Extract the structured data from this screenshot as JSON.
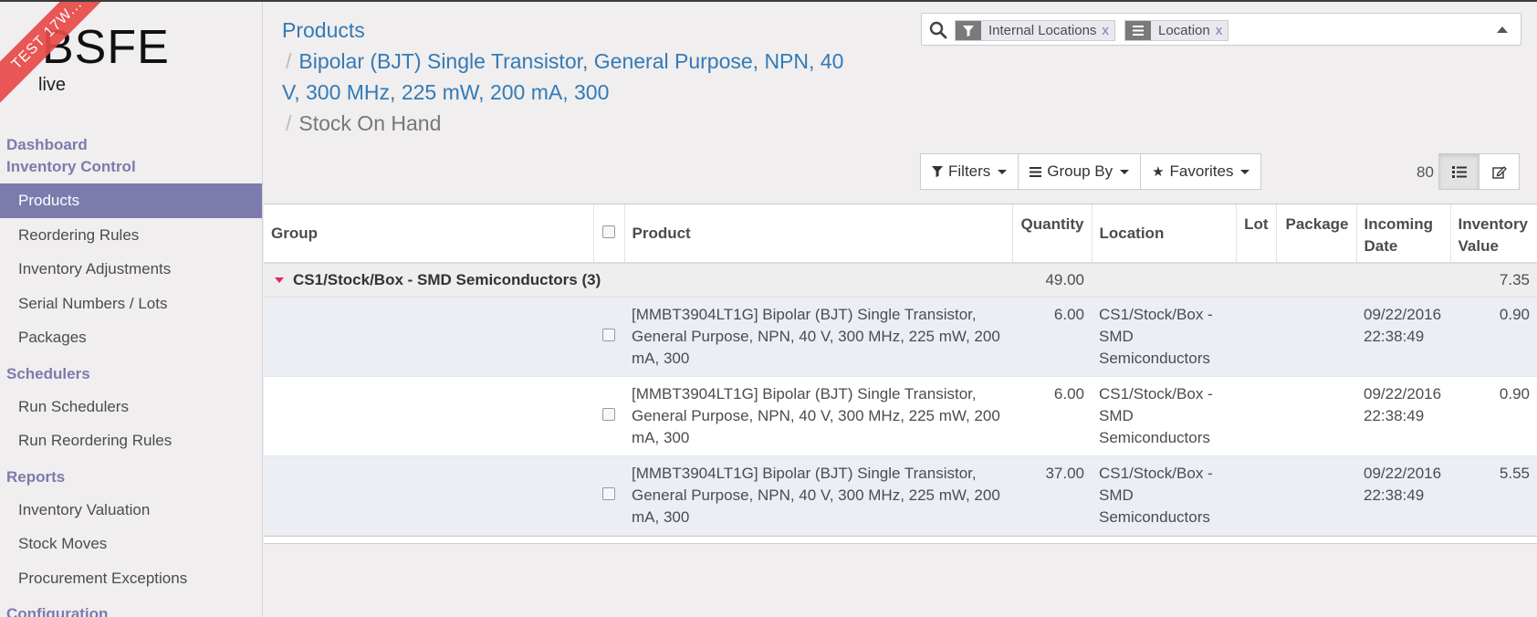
{
  "brand": {
    "logo": "BSFE",
    "sub": "live",
    "ribbon": "TEST 17W..."
  },
  "sidebar": {
    "dashboard": "Dashboard",
    "sections": [
      {
        "title": "Inventory Control",
        "items": [
          "Products",
          "Reordering Rules",
          "Inventory Adjustments",
          "Serial Numbers / Lots",
          "Packages"
        ]
      },
      {
        "title": "Schedulers",
        "items": [
          "Run Schedulers",
          "Run Reordering Rules"
        ]
      },
      {
        "title": "Reports",
        "items": [
          "Inventory Valuation",
          "Stock Moves",
          "Procurement Exceptions"
        ]
      },
      {
        "title": "Configuration",
        "items": []
      }
    ],
    "active_item": "Products"
  },
  "breadcrumb": {
    "root": "Products",
    "middle": "Bipolar (BJT) Single Transistor, General Purpose, NPN, 40 V, 300 MHz, 225 mW, 200 mA, 300",
    "current": "Stock On Hand"
  },
  "search": {
    "facets": [
      {
        "icon": "filter-icon",
        "label": "Internal Locations",
        "remove": "x"
      },
      {
        "icon": "group-icon",
        "label": "Location",
        "remove": "x"
      }
    ]
  },
  "toolbar": {
    "filters": "Filters",
    "group_by": "Group By",
    "favorites": "Favorites",
    "pager": "80"
  },
  "table": {
    "columns": [
      "Group",
      "",
      "Product",
      "Quantity",
      "Location",
      "Lot",
      "Package",
      "Incoming Date",
      "Inventory Value"
    ],
    "group": {
      "label": "CS1/Stock/Box - SMD Semiconductors (3)",
      "quantity": "49.00",
      "value": "7.35"
    },
    "rows": [
      {
        "product": "[MMBT3904LT1G] Bipolar (BJT) Single Transistor, General Purpose, NPN, 40 V, 300 MHz, 225 mW, 200 mA, 300",
        "quantity": "6.00",
        "location": "CS1/Stock/Box - SMD Semiconductors",
        "lot": "",
        "package": "",
        "date": "09/22/2016 22:38:49",
        "value": "0.90"
      },
      {
        "product": "[MMBT3904LT1G] Bipolar (BJT) Single Transistor, General Purpose, NPN, 40 V, 300 MHz, 225 mW, 200 mA, 300",
        "quantity": "6.00",
        "location": "CS1/Stock/Box - SMD Semiconductors",
        "lot": "",
        "package": "",
        "date": "09/22/2016 22:38:49",
        "value": "0.90"
      },
      {
        "product": "[MMBT3904LT1G] Bipolar (BJT) Single Transistor, General Purpose, NPN, 40 V, 300 MHz, 225 mW, 200 mA, 300",
        "quantity": "37.00",
        "location": "CS1/Stock/Box - SMD Semiconductors",
        "lot": "",
        "package": "",
        "date": "09/22/2016 22:38:49",
        "value": "5.55"
      }
    ]
  },
  "colors": {
    "accent": "#7c7bad",
    "link": "#337ab7",
    "ribbon": "#e84a4a",
    "group_caret": "#e0256d"
  }
}
